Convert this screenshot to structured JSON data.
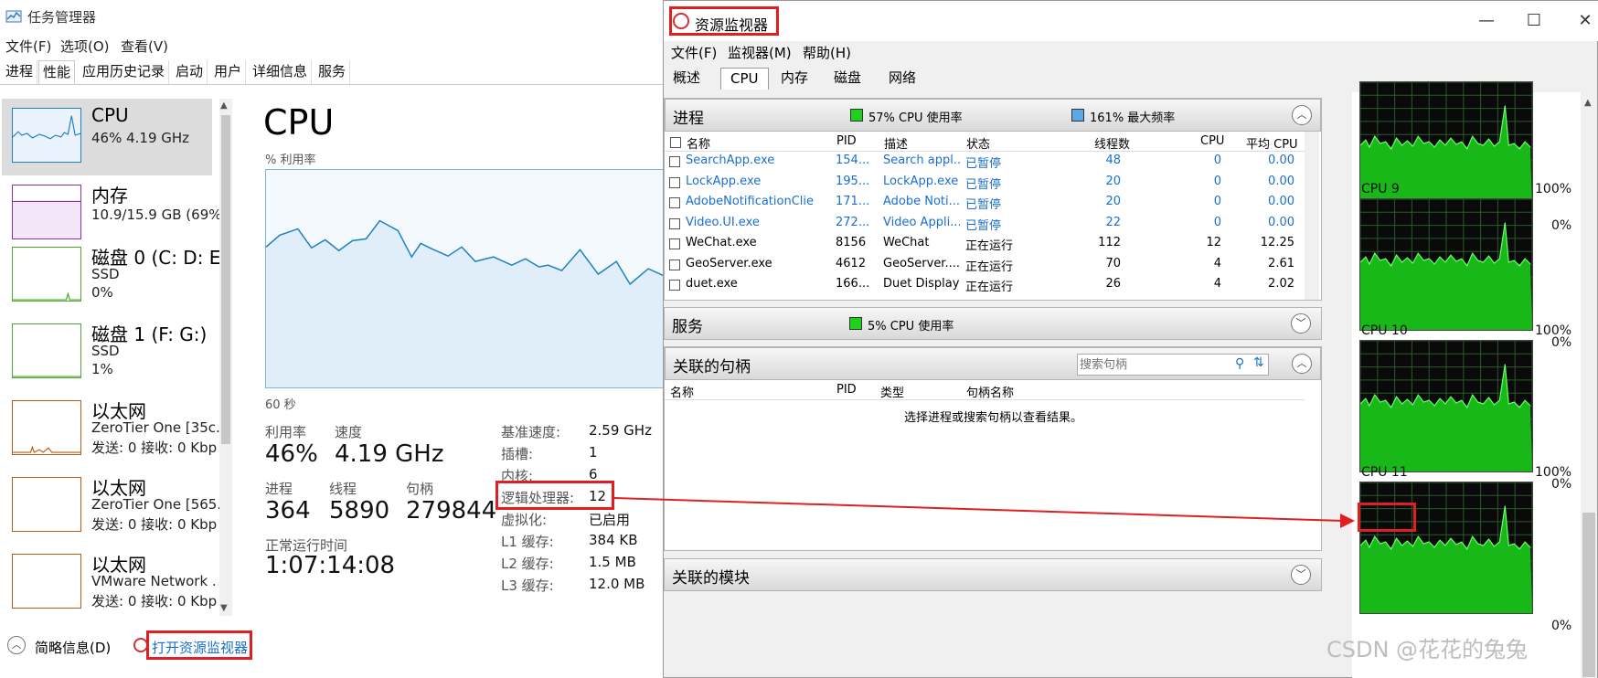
{
  "task_manager": {
    "title": "任务管理器",
    "menu": [
      "文件(F)",
      "选项(O)",
      "查看(V)"
    ],
    "tabs": [
      "进程",
      "性能",
      "应用历史记录",
      "启动",
      "用户",
      "详细信息",
      "服务"
    ],
    "active_tab": "性能",
    "sidebar": [
      {
        "name": "CPU",
        "sub1": "46% 4.19 GHz",
        "sub2": "",
        "sub3": "",
        "color": "#1f7fc3"
      },
      {
        "name": "内存",
        "sub1": "10.9/15.9 GB (69%)",
        "sub2": "",
        "sub3": "",
        "color": "#8b2fa8"
      },
      {
        "name": "磁盘 0 (C: D: E:",
        "sub1": "SSD",
        "sub2": "0%",
        "sub3": "",
        "color": "#4fa82e"
      },
      {
        "name": "磁盘 1 (F: G:)",
        "sub1": "SSD",
        "sub2": "1%",
        "sub3": "",
        "color": "#4fa82e"
      },
      {
        "name": "以太网",
        "sub1": "ZeroTier One [35c.",
        "sub2": "发送: 0 接收: 0 Kbp",
        "sub3": "",
        "color": "#b45f16"
      },
      {
        "name": "以太网",
        "sub1": "ZeroTier One [565.",
        "sub2": "发送: 0 接收: 0 Kbp",
        "sub3": "",
        "color": "#b45f16"
      },
      {
        "name": "以太网",
        "sub1": "VMware Network .",
        "sub2": "发送: 0 接收: 0 Kbp",
        "sub3": "",
        "color": "#b45f16"
      }
    ],
    "cpu_title": "CPU",
    "graph_label": "% 利用率",
    "graph_time": "60 秒",
    "stats": {
      "util_label": "利用率",
      "util_value": "46%",
      "speed_label": "速度",
      "speed_value": "4.19 GHz",
      "proc_label": "进程",
      "proc_value": "364",
      "thread_label": "线程",
      "thread_value": "5890",
      "handle_label": "句柄",
      "handle_value": "279844",
      "uptime_label": "正常运行时间",
      "uptime_value": "1:07:14:08"
    },
    "info": [
      {
        "label": "基准速度:",
        "value": "2.59 GHz"
      },
      {
        "label": "插槽:",
        "value": "1"
      },
      {
        "label": "内核:",
        "value": "6"
      },
      {
        "label": "逻辑处理器:",
        "value": "12"
      },
      {
        "label": "虚拟化:",
        "value": "已启用"
      },
      {
        "label": "L1 缓存:",
        "value": "384 KB"
      },
      {
        "label": "L2 缓存:",
        "value": "1.5 MB"
      },
      {
        "label": "L3 缓存:",
        "value": "12.0 MB"
      }
    ],
    "bottom_brief": "简略信息(D)",
    "bottom_link": "打开资源监视器"
  },
  "resource_monitor": {
    "title": "资源监视器",
    "menu": [
      "文件(F)",
      "监视器(M)",
      "帮助(H)"
    ],
    "tabs": [
      "概述",
      "CPU",
      "内存",
      "磁盘",
      "网络"
    ],
    "active_tab": "CPU",
    "process_section": {
      "title": "进程",
      "cpu_usage": "57% CPU 使用率",
      "max_freq": "161% 最大频率",
      "columns": [
        "名称",
        "PID",
        "描述",
        "状态",
        "线程数",
        "CPU",
        "平均 CPU"
      ],
      "rows": [
        {
          "name": "SearchApp.exe",
          "pid": "154...",
          "desc": "Search appl...",
          "status": "已暂停",
          "threads": "48",
          "cpu": "0",
          "avg": "0.00",
          "suspended": true
        },
        {
          "name": "LockApp.exe",
          "pid": "195...",
          "desc": "LockApp.exe",
          "status": "已暂停",
          "threads": "20",
          "cpu": "0",
          "avg": "0.00",
          "suspended": true
        },
        {
          "name": "AdobeNotificationClien...",
          "pid": "171...",
          "desc": "Adobe Noti...",
          "status": "已暂停",
          "threads": "20",
          "cpu": "0",
          "avg": "0.00",
          "suspended": true
        },
        {
          "name": "Video.UI.exe",
          "pid": "272...",
          "desc": "Video Appli...",
          "status": "已暂停",
          "threads": "22",
          "cpu": "0",
          "avg": "0.00",
          "suspended": true
        },
        {
          "name": "WeChat.exe",
          "pid": "8156",
          "desc": "WeChat",
          "status": "正在运行",
          "threads": "112",
          "cpu": "12",
          "avg": "12.25",
          "suspended": false
        },
        {
          "name": "GeoServer.exe",
          "pid": "4612",
          "desc": "GeoServer....",
          "status": "正在运行",
          "threads": "70",
          "cpu": "4",
          "avg": "2.61",
          "suspended": false
        },
        {
          "name": "duet.exe",
          "pid": "166...",
          "desc": "Duet Display",
          "status": "正在运行",
          "threads": "26",
          "cpu": "4",
          "avg": "2.02",
          "suspended": false
        }
      ]
    },
    "services_section": {
      "title": "服务",
      "cpu_usage": "5% CPU 使用率"
    },
    "handles_section": {
      "title": "关联的句柄",
      "search_placeholder": "搜索句柄",
      "columns": [
        "名称",
        "PID",
        "类型",
        "句柄名称"
      ],
      "empty_message": "选择进程或搜索句柄以查看结果。"
    },
    "modules_section": {
      "title": "关联的模块"
    },
    "cpu_graphs": [
      {
        "label": "",
        "max": "",
        "min": "0%"
      },
      {
        "label": "CPU 9",
        "max": "100%",
        "min": "0%"
      },
      {
        "label": "CPU 10",
        "max": "100%",
        "min": "0%"
      },
      {
        "label": "CPU 11",
        "max": "100%",
        "min": "0%"
      }
    ]
  },
  "watermark": "CSDN @花花的兔兔",
  "colors": {
    "accent": "#1f7fc3",
    "highlight": "#e02020",
    "graph_green": "#1fd01f"
  }
}
